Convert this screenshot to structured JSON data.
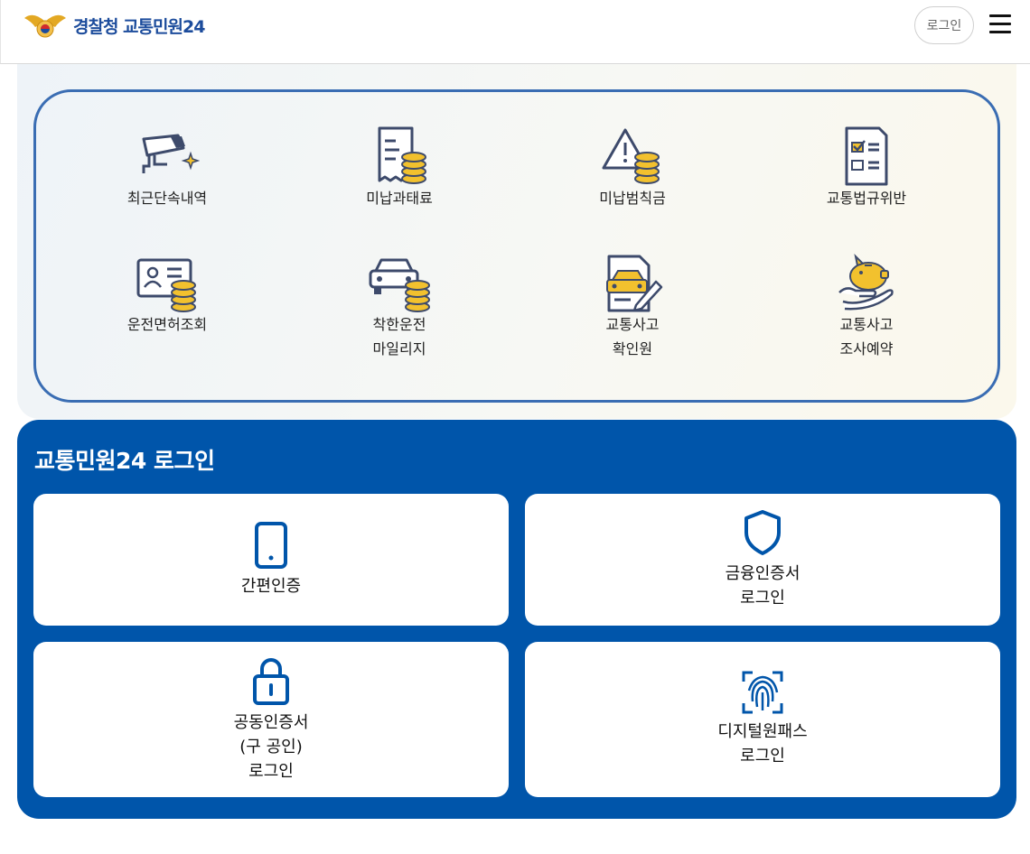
{
  "header": {
    "logo_text": "경찰청 교통민원24",
    "login_button": "로그인",
    "menu_icon": "hamburger-icon"
  },
  "menu": {
    "items": [
      {
        "label": "최근단속내역",
        "icon": "cctv-camera-icon"
      },
      {
        "label": "미납과태료",
        "icon": "receipt-coins-icon"
      },
      {
        "label": "미납범칙금",
        "icon": "warning-coins-icon"
      },
      {
        "label": "교통법규위반",
        "icon": "checklist-icon"
      },
      {
        "label": "운전면허조회",
        "icon": "id-card-coins-icon"
      },
      {
        "label_line1": "착한운전",
        "label_line2": "마일리지",
        "icon": "car-coins-icon"
      },
      {
        "label_line1": "교통사고",
        "label_line2": "확인원",
        "icon": "accident-document-icon"
      },
      {
        "label_line1": "교통사고",
        "label_line2": "조사예약",
        "icon": "piggy-bank-hand-icon"
      }
    ]
  },
  "login": {
    "title": "교통민원24 로그인",
    "cards": [
      {
        "line1": "간편인증",
        "icon": "smartphone-icon"
      },
      {
        "line1": "금융인증서",
        "line2": "로그인",
        "icon": "shield-icon"
      },
      {
        "line1": "공동인증서",
        "line2": "(구 공인)",
        "line3": "로그인",
        "icon": "lock-icon"
      },
      {
        "line1": "디지털원패스",
        "line2": "로그인",
        "icon": "fingerprint-icon"
      }
    ]
  },
  "colors": {
    "brand_blue": "#0055aa",
    "menu_border": "#3a6db3",
    "icon_navy": "#3d4a6b",
    "coin_gold": "#f2c12e"
  }
}
